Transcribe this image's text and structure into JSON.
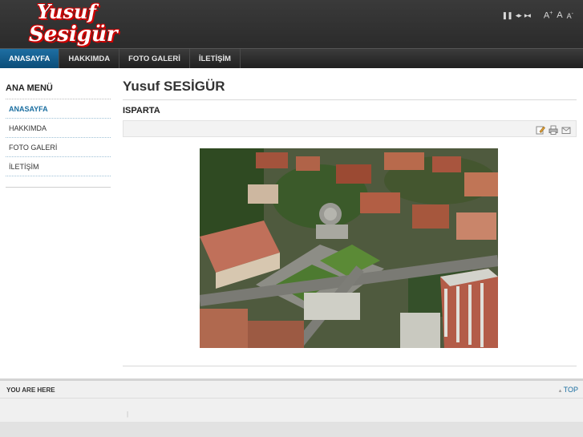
{
  "header": {
    "logo_line1": "Yusuf",
    "logo_line2": "Sesigür",
    "controls": {
      "pause": "❚❚",
      "prev": "◂▸",
      "next": "▸◂"
    },
    "font_sizes": {
      "increase": "A",
      "increase_mark": "+",
      "reset": "A",
      "decrease": "A",
      "decrease_mark": "-"
    }
  },
  "nav": {
    "items": [
      {
        "label": "ANASAYFA",
        "active": true
      },
      {
        "label": "HAKKIMDA",
        "active": false
      },
      {
        "label": "FOTO GALERİ",
        "active": false
      },
      {
        "label": "İLETİŞİM",
        "active": false
      }
    ]
  },
  "sidebar": {
    "title": "ANA MENÜ",
    "items": [
      {
        "label": "ANASAYFA",
        "active": true
      },
      {
        "label": "HAKKIMDA",
        "active": false
      },
      {
        "label": "FOTO GALERİ",
        "active": false
      },
      {
        "label": "İLETİŞİM",
        "active": false
      }
    ]
  },
  "main": {
    "title": "Yusuf SESİGÜR",
    "article_title": "ISPARTA",
    "icons": [
      "edit-icon",
      "print-icon",
      "email-icon"
    ]
  },
  "footer": {
    "breadcrumb_label": "YOU ARE HERE",
    "top_arrow": "▴",
    "top_label": "TOP",
    "tick": "|"
  },
  "colors": {
    "accent": "#1a6ea0",
    "nav_active": "#0b4d78",
    "logo_red": "#d10000",
    "header_bg": "#2b2b2b"
  }
}
